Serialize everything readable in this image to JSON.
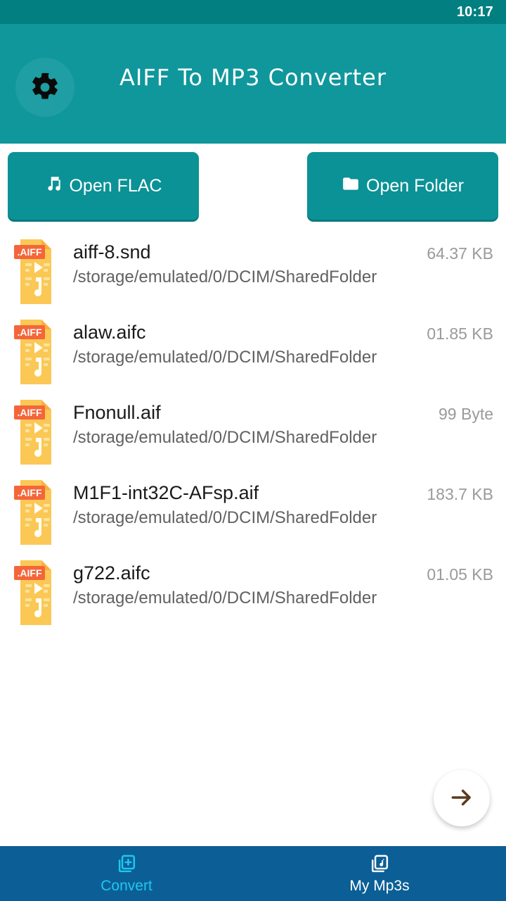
{
  "status_bar": {
    "time": "10:17"
  },
  "app_bar": {
    "title": "AIFF To MP3 Converter",
    "settings_icon": "gear-icon"
  },
  "actions": {
    "open_file": {
      "label": "Open FLAC",
      "icon": "music-note-icon"
    },
    "open_folder": {
      "label": "Open Folder",
      "icon": "folder-icon"
    }
  },
  "file_list": {
    "icon_badge": ".AIFF",
    "items": [
      {
        "name": "aiff-8.snd",
        "path": "/storage/emulated/0/DCIM/SharedFolder",
        "size": "64.37 KB"
      },
      {
        "name": "alaw.aifc",
        "path": "/storage/emulated/0/DCIM/SharedFolder",
        "size": "01.85 KB"
      },
      {
        "name": "Fnonull.aif",
        "path": "/storage/emulated/0/DCIM/SharedFolder",
        "size": "99 Byte"
      },
      {
        "name": "M1F1-int32C-AFsp.aif",
        "path": "/storage/emulated/0/DCIM/SharedFolder",
        "size": "183.7 KB"
      },
      {
        "name": "g722.aifc",
        "path": "/storage/emulated/0/DCIM/SharedFolder",
        "size": "01.05 KB"
      }
    ]
  },
  "fab": {
    "icon": "arrow-right-icon"
  },
  "bottom_nav": {
    "items": [
      {
        "label": "Convert",
        "icon": "file-plus-icon",
        "active": true
      },
      {
        "label": "My Mp3s",
        "icon": "file-music-icon",
        "active": false
      }
    ]
  },
  "colors": {
    "status_bar": "#027f80",
    "app_bar": "#0f979c",
    "button": "#0b9296",
    "bottom_nav": "#0b5f96",
    "nav_active": "#1ec8f0",
    "file_icon": "#fbc855",
    "badge": "#f4663a"
  }
}
